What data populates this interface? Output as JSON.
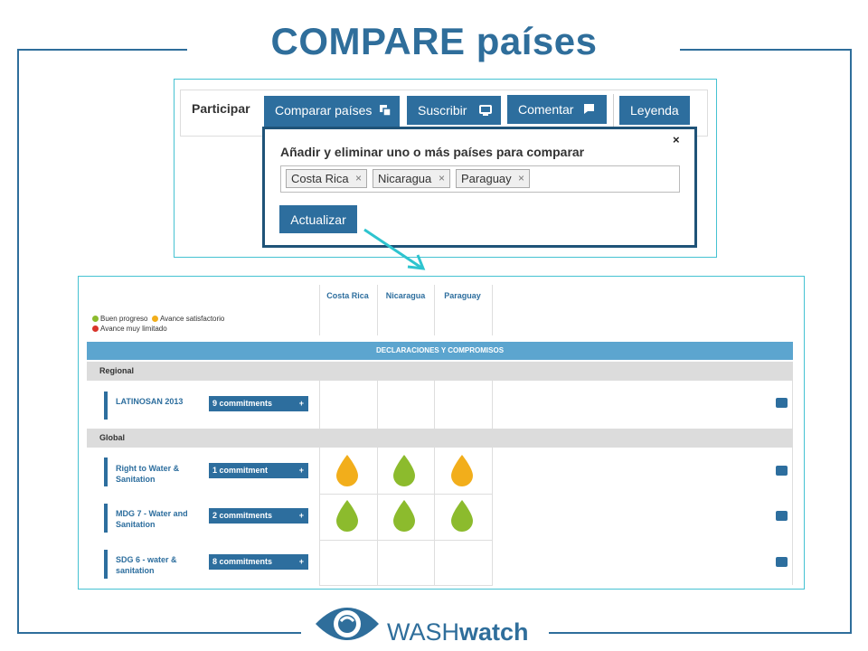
{
  "slide": {
    "title": "COMPARE países"
  },
  "nav": {
    "participate_label": "Participar",
    "tabs": [
      {
        "label": "Comparar países",
        "icon": "compare-icon"
      },
      {
        "label": "Suscribir",
        "icon": "monitor-icon"
      },
      {
        "label": "Comentar",
        "icon": "comment-icon"
      },
      {
        "label": "Leyenda"
      }
    ]
  },
  "popup": {
    "heading": "Añadir y eliminar uno o más países para comparar",
    "close": "×",
    "selected_countries": [
      "Costa Rica",
      "Nicaragua",
      "Paraguay"
    ],
    "chip_remove": "×",
    "update_button": "Actualizar"
  },
  "table": {
    "legend": [
      {
        "label": "Buen progreso",
        "color": "#8cbb2d"
      },
      {
        "label": "Avance satisfactorio",
        "color": "#f2ae1b"
      },
      {
        "label": "Avance muy limitado",
        "color": "#d9342b"
      }
    ],
    "countries": [
      "Costa Rica",
      "Nicaragua",
      "Paraguay"
    ],
    "section_title": "DECLARACIONES Y COMPROMISOS",
    "groups": [
      {
        "name": "Regional",
        "rows": [
          {
            "name": "LATINOSAN 2013",
            "commitments": "9 commitments",
            "status": [
              null,
              null,
              null
            ]
          }
        ]
      },
      {
        "name": "Global",
        "rows": [
          {
            "name": "Right to Water & Sanitation",
            "commitments": "1 commitment",
            "status": [
              "satisfactory",
              "good",
              "satisfactory"
            ]
          },
          {
            "name": "MDG 7 - Water and Sanitation",
            "commitments": "2 commitments",
            "status": [
              "good",
              "good",
              "good"
            ]
          },
          {
            "name": "SDG 6 - water & sanitation",
            "commitments": "8 commitments",
            "status": [
              null,
              null,
              null
            ]
          }
        ]
      }
    ],
    "plus": "+",
    "status_colors": {
      "good": "#8cbb2d",
      "satisfactory": "#f2ae1b",
      "limited": "#d9342b"
    }
  },
  "logo": {
    "part1": "WASH",
    "part2": "watch",
    "icon": "eye-icon",
    "color": "#2f6e9b"
  }
}
